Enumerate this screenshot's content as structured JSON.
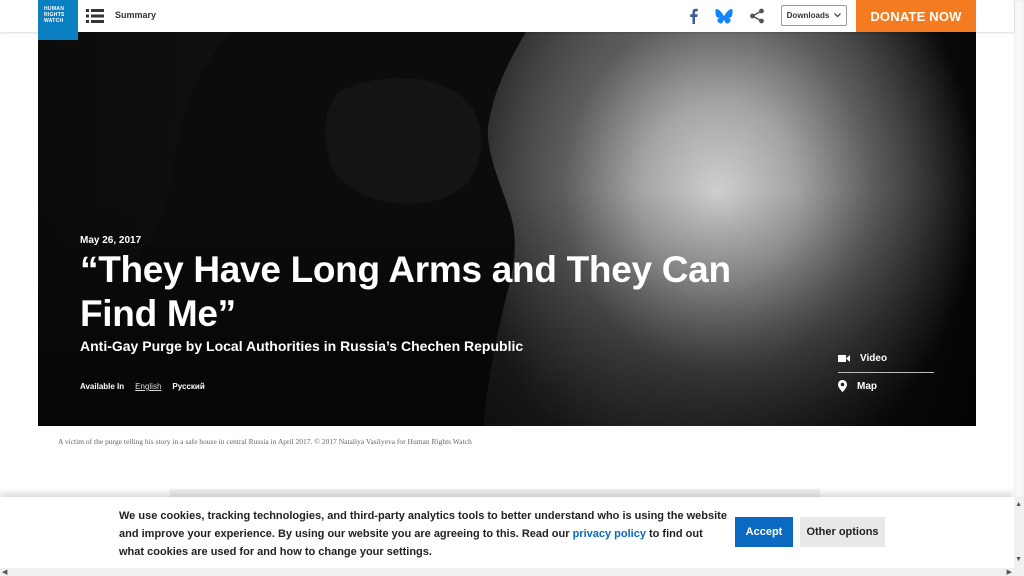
{
  "header": {
    "logo_text": [
      "HUMAN",
      "RIGHTS",
      "WATCH"
    ],
    "menu_icon": "hamburger-list-icon",
    "summary_label": "Summary",
    "social_icons": [
      "facebook-icon",
      "bluesky-icon",
      "share-icon"
    ],
    "downloads_label": "Downloads",
    "donate_label": "DONATE NOW",
    "colors": {
      "brand_blue": "#0a7fc2",
      "donate_orange": "#f47b20"
    }
  },
  "hero": {
    "date": "May 26, 2017",
    "title": "“They Have Long Arms and They Can Find Me”",
    "subtitle": "Anti-Gay Purge by Local Authorities in Russia’s Chechen Republic",
    "available_in_label": "Available In",
    "languages": [
      "English",
      "Русский"
    ],
    "media_links": [
      {
        "label": "Video",
        "icon": "video-camera-icon"
      },
      {
        "label": "Map",
        "icon": "map-pin-icon"
      }
    ]
  },
  "caption": "A victim of the purge telling his story in a safe house in central Russia in April 2017. © 2017 Nataliya Vasilyeva for Human Rights Watch",
  "cookie_banner": {
    "text_before_link": "We use cookies, tracking technologies, and third-party analytics tools to better understand who is using the website and improve your experience. By using our website you are agreeing to this. Read our ",
    "link_text": "privacy policy",
    "text_after_link": " to find out what cookies are used for and how to change your settings.",
    "accept_label": "Accept",
    "other_label": "Other options",
    "accent_color": "#0a6ac2"
  }
}
